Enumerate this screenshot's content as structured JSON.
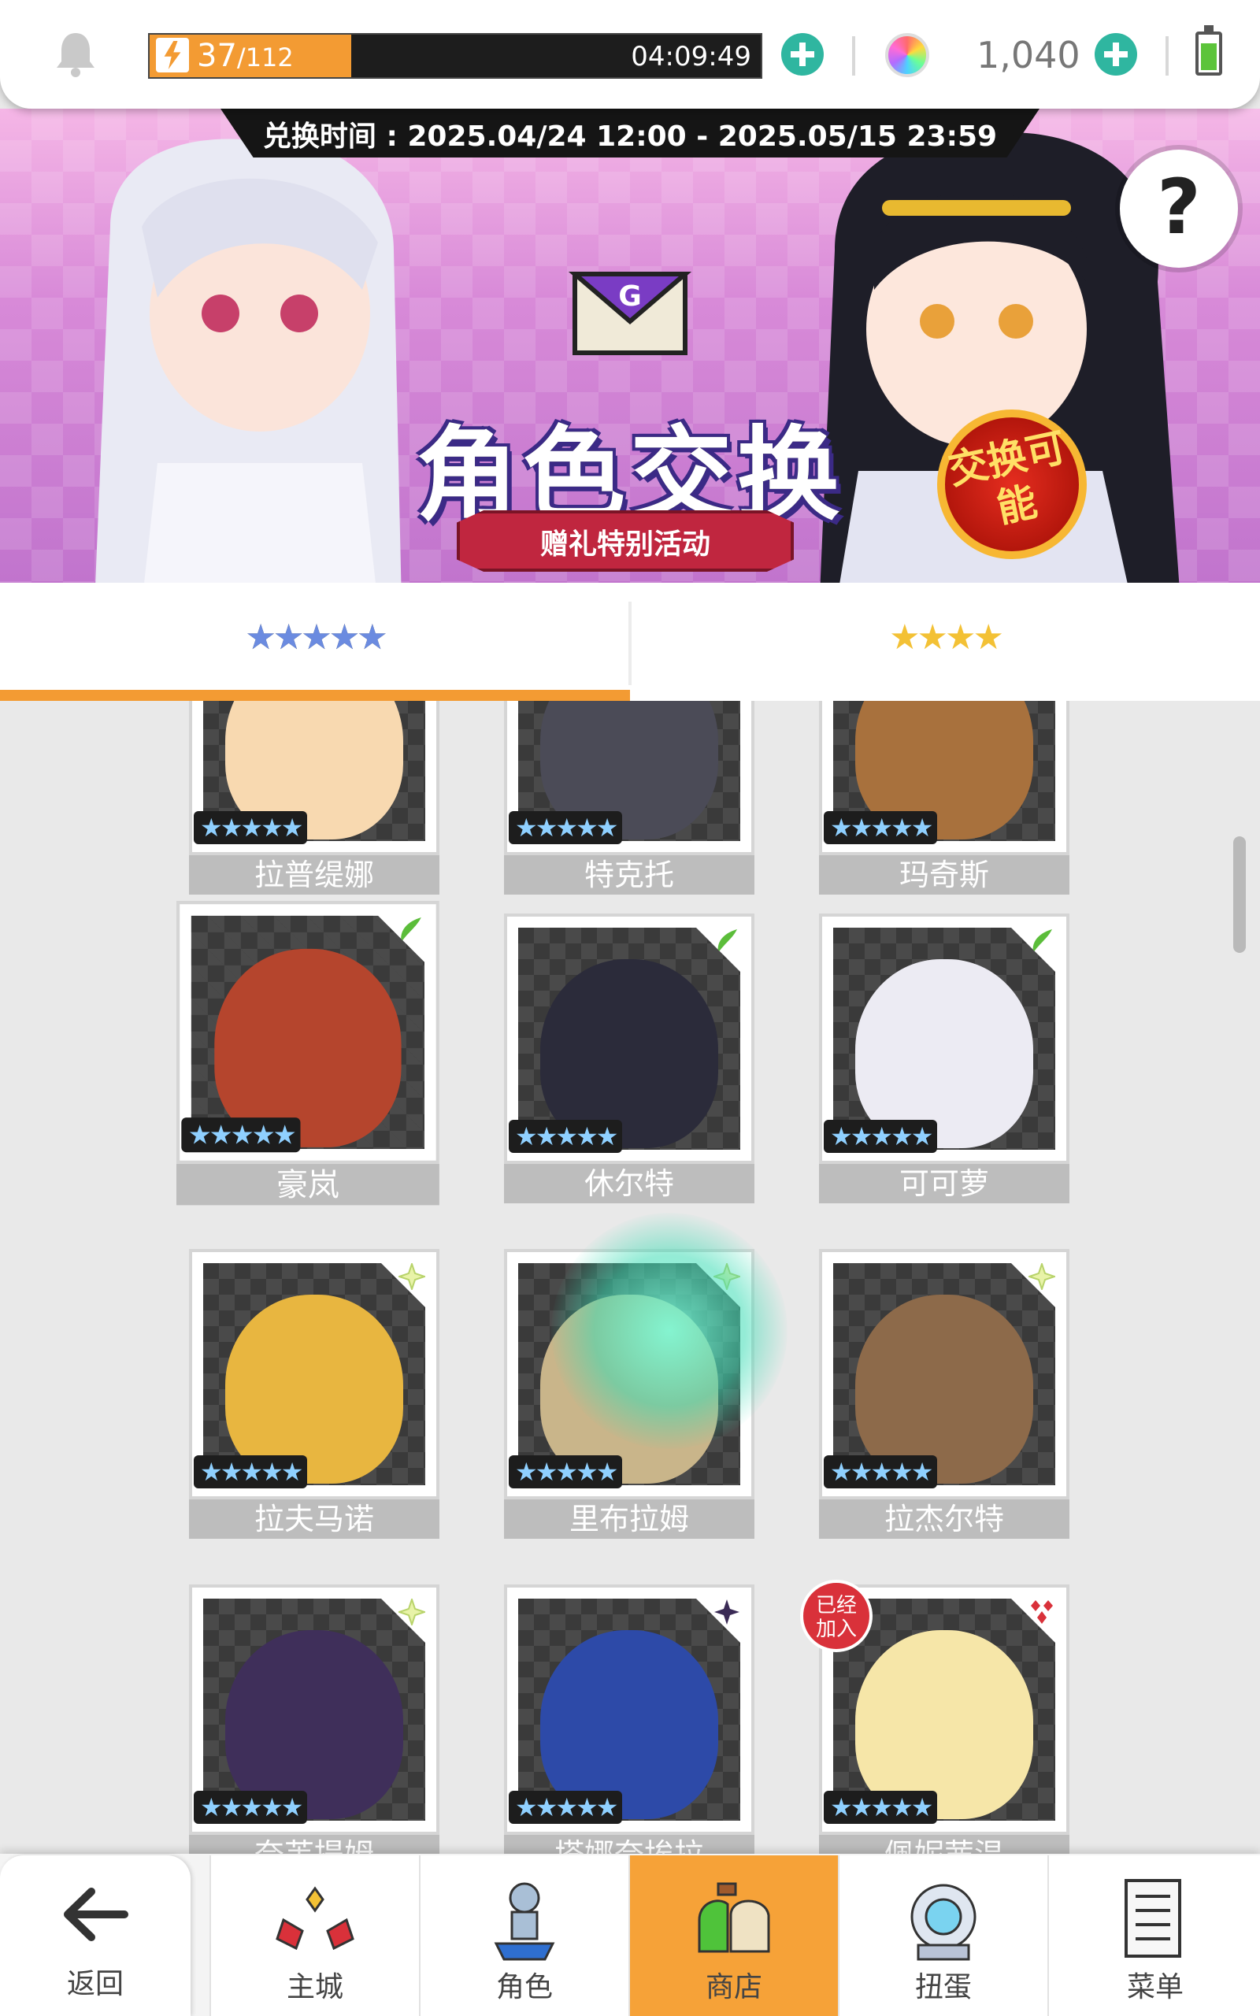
{
  "status": {
    "stamina_current": "37",
    "stamina_max": "/112",
    "stamina_fraction": 0.33,
    "timer": "04:09:49",
    "gem_count": "1,040",
    "battery_level": 0.7
  },
  "banner": {
    "exchange_period": "兑换时间 : 2025.04/24 12:00 - 2025.05/15 23:59",
    "title": "角色交换",
    "subtitle": "赠礼特别活动",
    "badge": "交换可能",
    "help": "?"
  },
  "tabs": [
    {
      "label": "★★★★★",
      "active": true
    },
    {
      "label": "★★★★",
      "active": false
    }
  ],
  "characters": [
    {
      "name": "拉普缇娜",
      "stars": "★★★★★"
    },
    {
      "name": "特克托",
      "stars": "★★★★★"
    },
    {
      "name": "玛奇斯",
      "stars": "★★★★★"
    },
    {
      "name": "豪岚",
      "stars": "★★★★★"
    },
    {
      "name": "休尔特",
      "stars": "★★★★★"
    },
    {
      "name": "可可萝",
      "stars": "★★★★★"
    },
    {
      "name": "拉夫马诺",
      "stars": "★★★★★"
    },
    {
      "name": "里布拉姆",
      "stars": "★★★★★"
    },
    {
      "name": "拉杰尔特",
      "stars": "★★★★★"
    },
    {
      "name": "奈芙提姆",
      "stars": "★★★★★"
    },
    {
      "name": "塔娜奈埃拉",
      "stars": "★★★★★"
    },
    {
      "name": "佩妮茜温",
      "stars": "★★★★★",
      "badge": "已经加入"
    }
  ],
  "nav": {
    "back": "返回",
    "items": [
      {
        "label": "主城"
      },
      {
        "label": "角色"
      },
      {
        "label": "商店",
        "active": true
      },
      {
        "label": "扭蛋"
      },
      {
        "label": "菜单"
      }
    ]
  },
  "colors": {
    "accent": "#f39b33",
    "tab_underline": "#f39b33",
    "plus_button": "#2fb6a0",
    "nav_active": "#f6a238"
  }
}
